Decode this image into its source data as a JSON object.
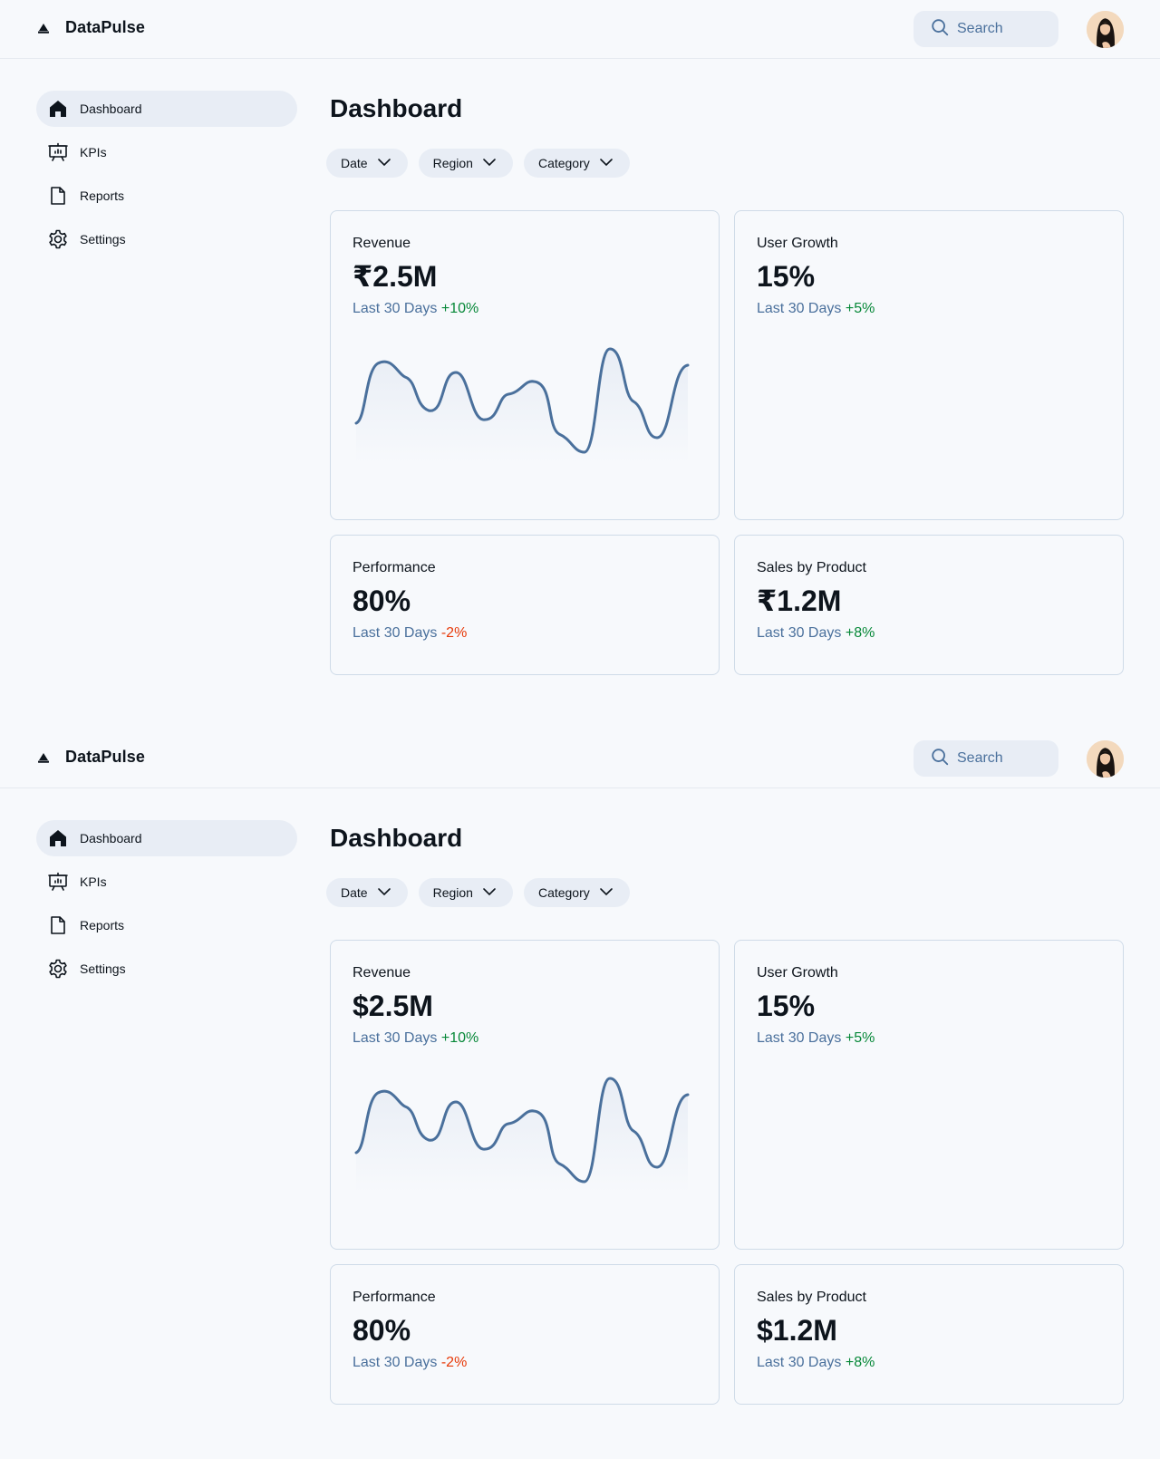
{
  "colors": {
    "background": "#f7f9fc",
    "surface": "#e8edf5",
    "border": "#cfdbe8",
    "text": "#0d141c",
    "muted": "#4a709c",
    "positive": "#078838",
    "negative": "#e73908"
  },
  "screens": [
    {
      "header": {
        "brand": "DataPulse",
        "logo_icon": "logo-icon",
        "search_placeholder": "Search"
      },
      "sidebar": {
        "items": [
          {
            "label": "Dashboard",
            "icon": "house-icon",
            "active": true
          },
          {
            "label": "KPIs",
            "icon": "presentation-chart-icon",
            "active": false
          },
          {
            "label": "Reports",
            "icon": "file-icon",
            "active": false
          },
          {
            "label": "Settings",
            "icon": "gear-icon",
            "active": false
          }
        ]
      },
      "main": {
        "title": "Dashboard",
        "filters": [
          "Date",
          "Region",
          "Category"
        ],
        "cards": {
          "revenue": {
            "label": "Revenue",
            "value": "₹2.5M",
            "period": "Last 30 Days",
            "delta": "+10%"
          },
          "user_growth": {
            "label": "User Growth",
            "value": "15%",
            "period": "Last 30 Days",
            "delta": "+5%"
          },
          "performance": {
            "label": "Performance",
            "value": "80%",
            "period": "Last 30 Days",
            "delta": "-2%"
          },
          "sales": {
            "label": "Sales by Product",
            "value": "₹1.2M",
            "period": "Last 30 Days",
            "delta": "+8%"
          }
        }
      }
    },
    {
      "header": {
        "brand": "DataPulse",
        "logo_icon": "logo-icon",
        "search_placeholder": "Search"
      },
      "sidebar": {
        "items": [
          {
            "label": "Dashboard",
            "icon": "house-icon",
            "active": true
          },
          {
            "label": "KPIs",
            "icon": "presentation-chart-icon",
            "active": false
          },
          {
            "label": "Reports",
            "icon": "file-icon",
            "active": false
          },
          {
            "label": "Settings",
            "icon": "gear-icon",
            "active": false
          }
        ]
      },
      "main": {
        "title": "Dashboard",
        "filters": [
          "Date",
          "Region",
          "Category"
        ],
        "cards": {
          "revenue": {
            "label": "Revenue",
            "value": "$2.5M",
            "period": "Last 30 Days",
            "delta": "+10%"
          },
          "user_growth": {
            "label": "User Growth",
            "value": "15%",
            "period": "Last 30 Days",
            "delta": "+5%"
          },
          "performance": {
            "label": "Performance",
            "value": "80%",
            "period": "Last 30 Days",
            "delta": "-2%"
          },
          "sales": {
            "label": "Sales by Product",
            "value": "$1.2M",
            "period": "Last 30 Days",
            "delta": "+8%"
          }
        }
      }
    }
  ]
}
